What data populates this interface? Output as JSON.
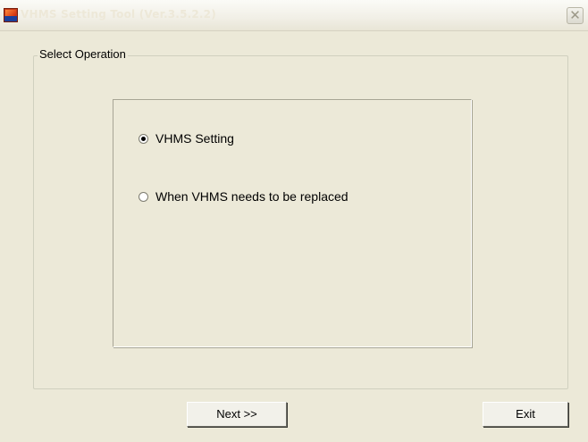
{
  "window": {
    "title": "VHMS Setting Tool  (Ver.3.5.2.2)",
    "close_glyph": "✕",
    "app_icon_name": "vhms-app-icon"
  },
  "group": {
    "legend": "Select Operation"
  },
  "options": [
    {
      "label": "VHMS Setting",
      "selected": true
    },
    {
      "label": "When VHMS needs to be replaced",
      "selected": false
    }
  ],
  "buttons": {
    "next_label": "Next >>",
    "exit_label": "Exit"
  }
}
